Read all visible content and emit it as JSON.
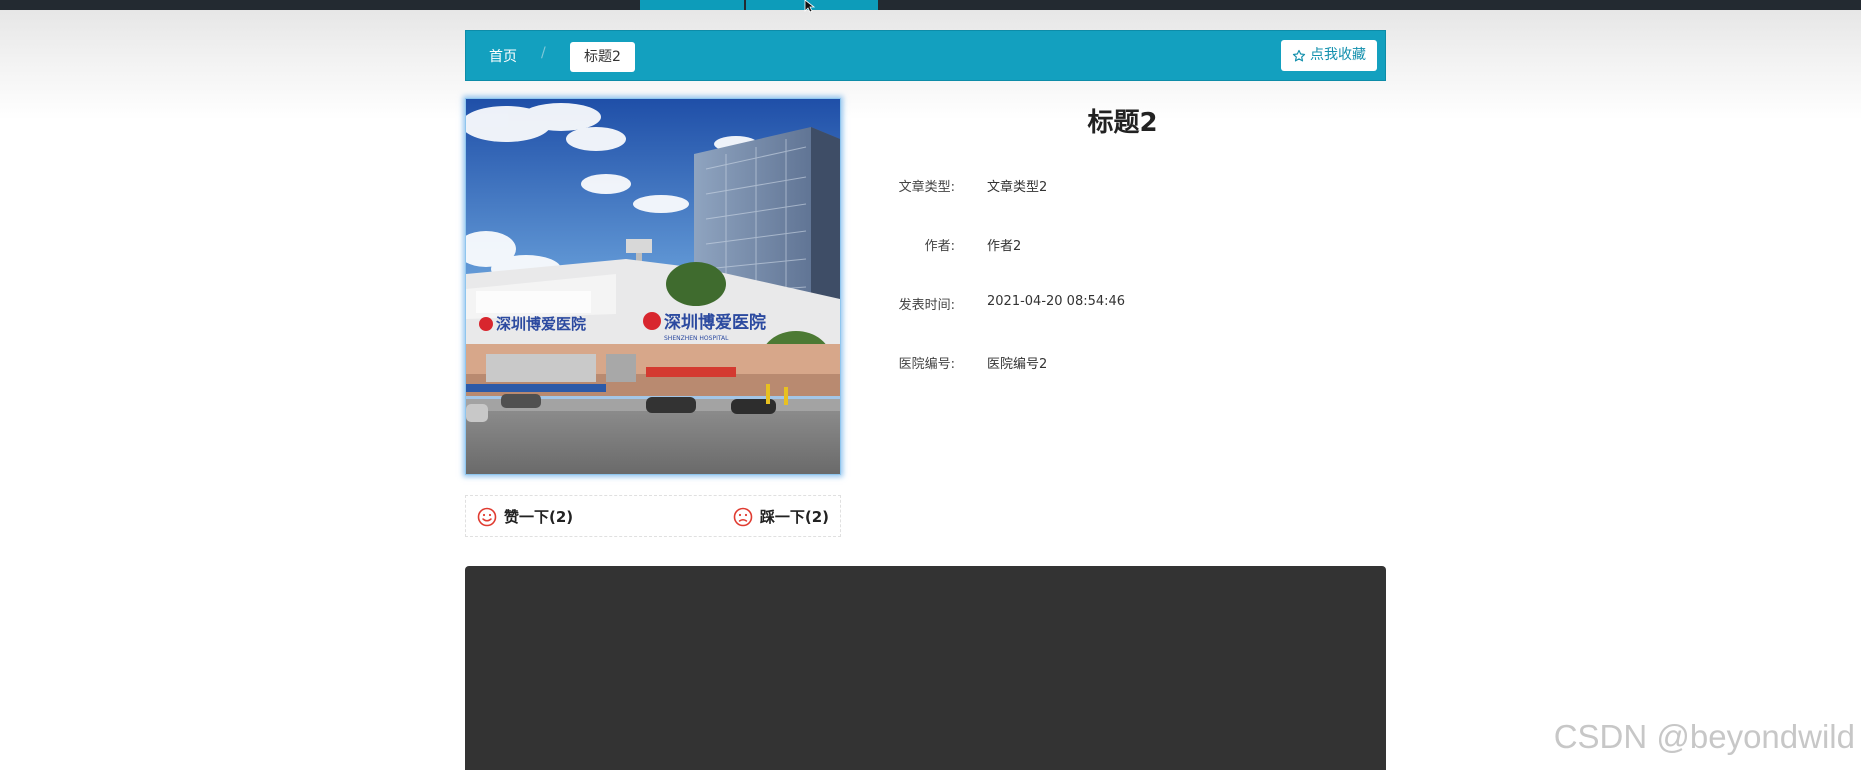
{
  "breadcrumb": {
    "home": "首页",
    "separator": "/",
    "current": "标题2"
  },
  "favorite_button": {
    "icon": "star-outline-icon",
    "label": "点我收藏"
  },
  "article": {
    "title": "标题2",
    "fields": [
      {
        "label": "文章类型:",
        "value": "文章类型2"
      },
      {
        "label": "作者:",
        "value": "作者2"
      },
      {
        "label": "发表时间:",
        "value": "2021-04-20 08:54:46"
      },
      {
        "label": "医院编号:",
        "value": "医院编号2"
      }
    ],
    "image_signage": {
      "chinese": "深圳博爱医院",
      "english": "SHENZHEN HOSPITAL"
    }
  },
  "votes": {
    "like": {
      "icon": "smile-icon",
      "label": "赞一下(2)"
    },
    "dislike": {
      "icon": "sad-icon",
      "label": "踩一下(2)"
    }
  },
  "watermark": "CSDN @beyondwild",
  "colors": {
    "nav_dark": "#232a31",
    "accent": "#13a0bf",
    "vote_icon": "#e03c31",
    "content_panel": "#333333"
  }
}
